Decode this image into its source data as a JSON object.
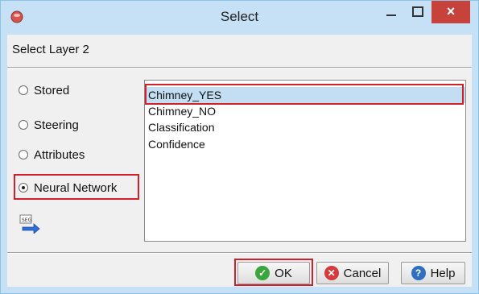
{
  "window": {
    "title": "Select",
    "close_glyph": "×",
    "minimize_glyph": "_",
    "maximize_glyph": "□"
  },
  "dialog": {
    "layer_label": "Select Layer 2"
  },
  "source_options": [
    {
      "label": "Stored",
      "selected": false
    },
    {
      "label": "Steering",
      "selected": false
    },
    {
      "label": "Attributes",
      "selected": false
    },
    {
      "label": "Neural Network",
      "selected": true
    }
  ],
  "list": {
    "items": [
      "Chimney_YES",
      "Chimney_NO",
      "Classification",
      "Confidence"
    ],
    "selected_index": 0
  },
  "buttons": {
    "ok": "OK",
    "cancel": "Cancel",
    "help": "Help"
  },
  "icons": {
    "app": "app-logo-icon",
    "seg_export": "seg-export-icon",
    "ok": "check-icon",
    "cancel": "x-icon",
    "help": "question-icon"
  },
  "colors": {
    "highlight_outline": "#d0202a",
    "selection": "#c3def2",
    "titlebar": "#c6e0f5",
    "close": "#c7423a"
  }
}
